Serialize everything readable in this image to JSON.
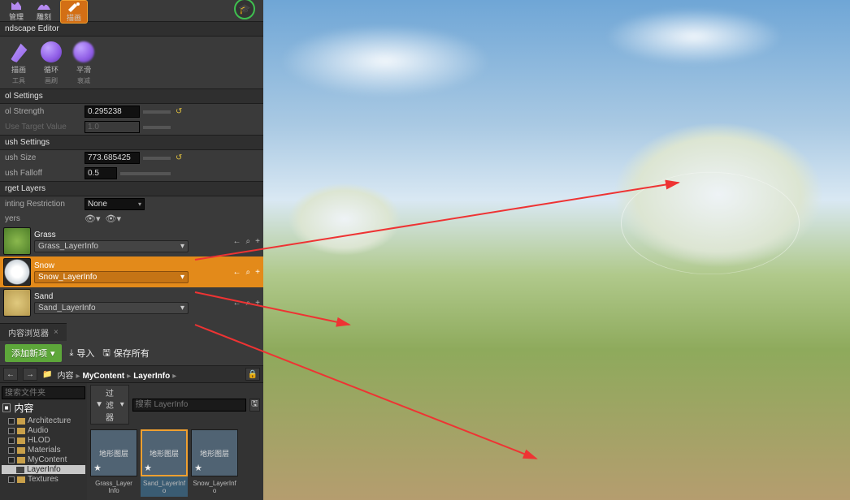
{
  "modes": {
    "manage": "管理",
    "sculpt": "雕刻",
    "paint": "描画"
  },
  "landscape_editor_label": "ndscape Editor",
  "tools": [
    {
      "name": "描画",
      "sub": "工具"
    },
    {
      "name": "循环",
      "sub": "画刷"
    },
    {
      "name": "平滑",
      "sub": "衰减"
    }
  ],
  "tool_settings": {
    "header": "ol Settings",
    "strength_label": "ol Strength",
    "strength_value": "0.295238",
    "use_target_label": "Use Target Value",
    "use_target_value": "1.0"
  },
  "brush_settings": {
    "header": "ush Settings",
    "size_label": "ush Size",
    "size_value": "773.685425",
    "falloff_label": "ush Falloff",
    "falloff_value": "0.5"
  },
  "target_layers": {
    "header": "rget Layers",
    "restriction_label": "inting Restriction",
    "restriction_value": "None",
    "layers_label": "yers",
    "items": [
      {
        "name": "Grass",
        "info": "Grass_LayerInfo"
      },
      {
        "name": "Snow",
        "info": "Snow_LayerInfo"
      },
      {
        "name": "Sand",
        "info": "Sand_LayerInfo"
      }
    ]
  },
  "content_browser": {
    "tab": "内容浏览器",
    "add_new": "添加新项",
    "import": "导入",
    "save_all": "保存所有",
    "path": {
      "root": "内容",
      "a": "MyContent",
      "b": "LayerInfo"
    },
    "tree_search_placeholder": "搜索文件夹",
    "tree_root": "内容",
    "tree_items": [
      "Architecture",
      "Audio",
      "HLOD",
      "Materials",
      "MyContent",
      "LayerInfo",
      "Textures"
    ],
    "filter_label": "过滤器",
    "asset_search_placeholder": "搜索 LayerInfo",
    "asset_type_label": "地形图层",
    "assets": [
      {
        "name": "Grass_Layer Info"
      },
      {
        "name": "Sand_LayerInf o"
      },
      {
        "name": "Snow_LayerInf o"
      }
    ]
  },
  "icons": {
    "reset": "↺",
    "back": "←",
    "find": "⌕",
    "plus": "+",
    "caret": "▾",
    "eye": "👁",
    "save": "🖫",
    "import": "⤓",
    "folder": "📁",
    "close": "×",
    "tut": "🎓",
    "star": "★",
    "lock": "🔒"
  }
}
